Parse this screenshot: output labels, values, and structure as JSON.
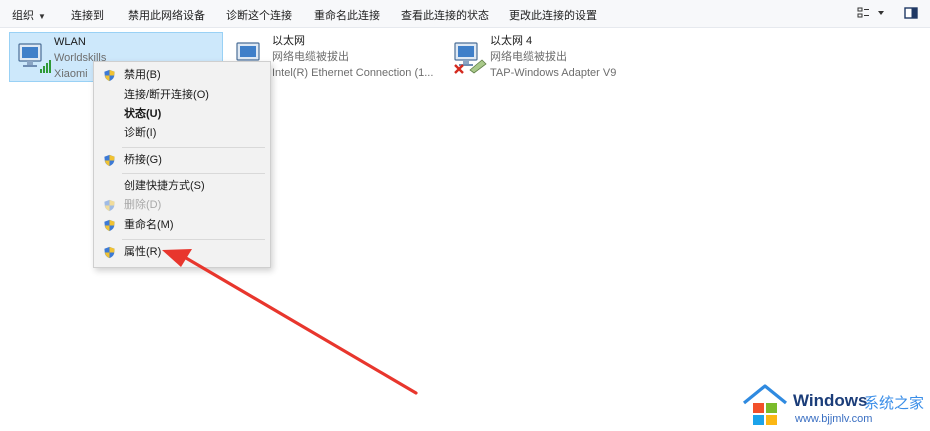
{
  "toolbar": {
    "items": [
      {
        "label": "组织",
        "has_caret": true
      },
      {
        "label": "连接到"
      },
      {
        "label": "禁用此网络设备"
      },
      {
        "label": "诊断这个连接"
      },
      {
        "label": "重命名此连接"
      },
      {
        "label": "查看此连接的状态"
      },
      {
        "label": "更改此连接的设置"
      }
    ],
    "view_options_icon": "view-options-icon",
    "preview_pane_icon": "preview-pane-icon"
  },
  "connections": [
    {
      "name": "WLAN",
      "line1": "Worldskills",
      "line2": "Xiaomi",
      "icon": "wifi-adapter-icon",
      "selected": true
    },
    {
      "name": "以太网",
      "line1": "网络电缆被拔出",
      "line2": "Intel(R) Ethernet Connection (1...",
      "icon": "ethernet-adapter-icon",
      "selected": false
    },
    {
      "name": "以太网 4",
      "line1": "网络电缆被拔出",
      "line2": "TAP-Windows Adapter V9",
      "icon": "ethernet-adapter-disconnected-icon",
      "selected": false
    }
  ],
  "context_menu": {
    "items": [
      {
        "label": "禁用(B)",
        "shield": true
      },
      {
        "label": "连接/断开连接(O)"
      },
      {
        "label": "状态(U)",
        "bold": true
      },
      {
        "label": "诊断(I)"
      },
      {
        "label": "桥接(G)",
        "shield": true
      },
      {
        "label": "创建快捷方式(S)"
      },
      {
        "label": "删除(D)",
        "shield": true,
        "disabled": true
      },
      {
        "label": "重命名(M)",
        "shield": true
      },
      {
        "label": "属性(R)",
        "shield": true
      }
    ]
  },
  "annotation": {
    "type": "arrow",
    "color": "#e8362d",
    "points_to": "属性(R)"
  },
  "watermark": {
    "title": "Windows",
    "subtitle_cn": "系统之家",
    "url": "www.bjjmlv.com"
  },
  "colors": {
    "selection_bg": "#cde8fb",
    "selection_border": "#99d1f5",
    "menu_bg": "#f2f2f2",
    "arrow": "#e8362d"
  }
}
